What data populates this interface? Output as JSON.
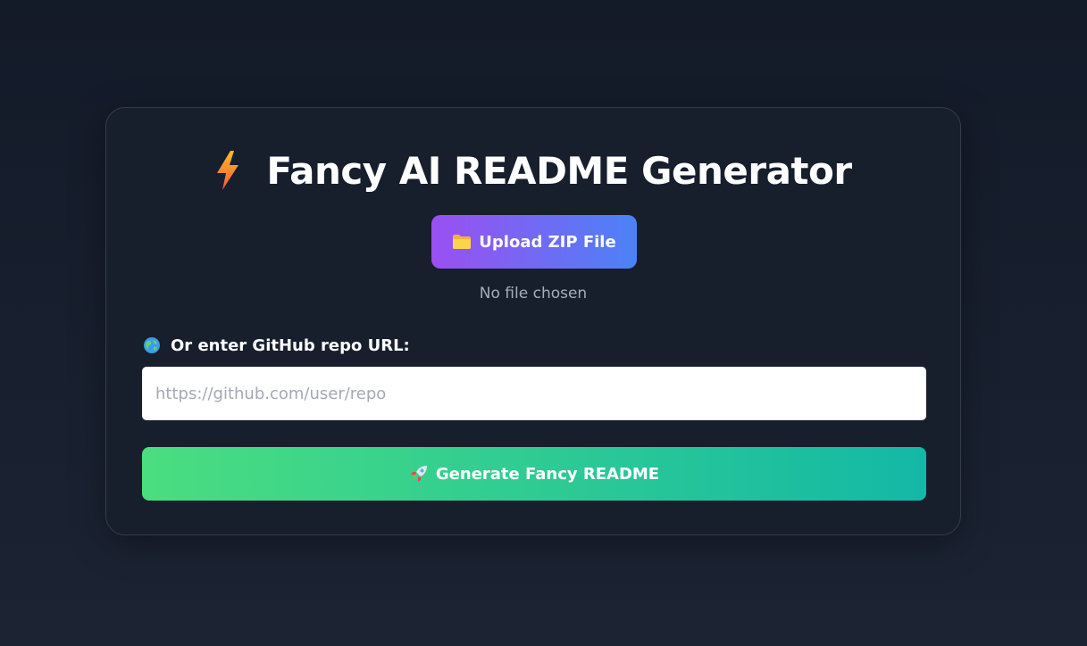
{
  "header": {
    "title": "Fancy AI README Generator",
    "icon": "lightning-bolt-icon"
  },
  "upload": {
    "button_label": "Upload ZIP File",
    "icon": "folder-icon",
    "file_status": "No file chosen"
  },
  "repo": {
    "label": "Or enter GitHub repo URL:",
    "icon": "globe-icon",
    "value": "",
    "placeholder": "https://github.com/user/repo"
  },
  "generate": {
    "button_label": "Generate Fancy README",
    "icon": "rocket-icon"
  },
  "colors": {
    "background": "#131a28",
    "card": "#171e2c",
    "upload_gradient_start": "#9b4ff2",
    "upload_gradient_end": "#4b82f6",
    "generate_gradient_start": "#4ade80",
    "generate_gradient_end": "#14b8a6"
  }
}
